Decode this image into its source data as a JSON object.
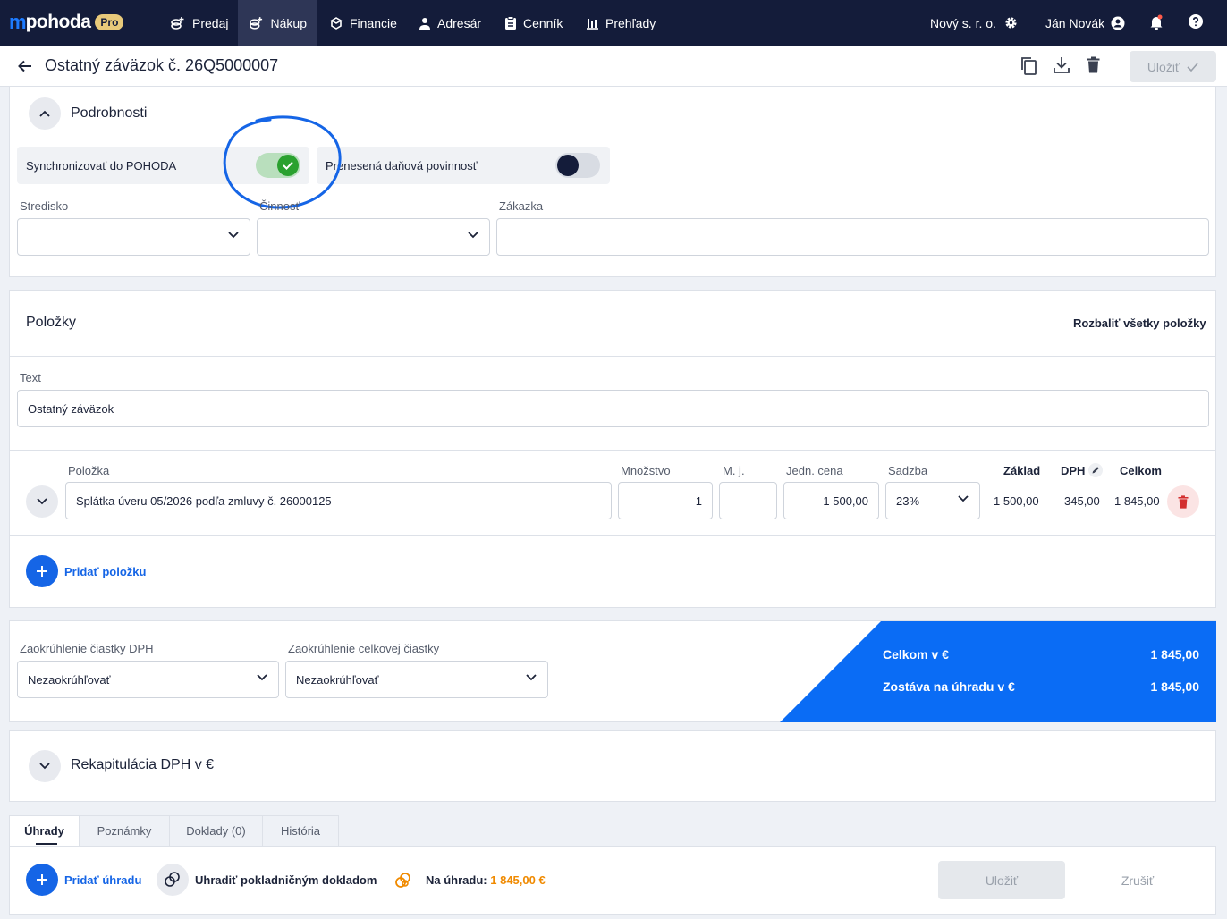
{
  "app": {
    "logo_mark": "m",
    "logo_text": "pohoda",
    "logo_badge": "Pro"
  },
  "nav": {
    "items": [
      {
        "label": "Predaj",
        "icon": "coins-plus-icon"
      },
      {
        "label": "Nákup",
        "icon": "coins-plus-icon",
        "active": true
      },
      {
        "label": "Financie",
        "icon": "finance-icon"
      },
      {
        "label": "Adresár",
        "icon": "person-icon"
      },
      {
        "label": "Cenník",
        "icon": "price-list-icon"
      },
      {
        "label": "Prehľady",
        "icon": "bar-chart-icon"
      }
    ],
    "company": "Nový s. r. o.",
    "user": "Ján Novák"
  },
  "header": {
    "title": "Ostatný záväzok č. 26Q5000007",
    "save_label": "Uložiť"
  },
  "details": {
    "title": "Podrobnosti",
    "sync_label": "Synchronizovať do POHODA",
    "sync_on": true,
    "reverse_charge_label": "Prenesená daňová povinnosť",
    "reverse_charge_on": false,
    "stredisko_label": "Stredisko",
    "cinnost_label": "Činnosť",
    "zakazka_label": "Zákazka"
  },
  "items": {
    "title": "Položky",
    "expand_all": "Rozbaliť všetky položky",
    "text_label": "Text",
    "text_value": "Ostatný záväzok",
    "columns": {
      "item": "Položka",
      "qty": "Množstvo",
      "unit": "M. j.",
      "unit_price": "Jedn. cena",
      "rate": "Sadzba",
      "base": "Základ",
      "vat": "DPH",
      "total": "Celkom"
    },
    "rows": [
      {
        "name": "Splátka úveru 05/2026 podľa zmluvy č. 26000125",
        "qty": "1",
        "unit": "",
        "unit_price": "1 500,00",
        "rate": "23%",
        "base": "1 500,00",
        "vat": "345,00",
        "total": "1 845,00"
      }
    ],
    "add_label": "Pridať položku"
  },
  "rounding": {
    "vat_label": "Zaokrúhlenie čiastky DPH",
    "vat_value": "Nezaokrúhľovať",
    "total_label": "Zaokrúhlenie celkovej čiastky",
    "total_value": "Nezaokrúhľovať"
  },
  "totals": {
    "total_label": "Celkom v €",
    "total_value": "1 845,00",
    "remaining_label": "Zostáva na úhradu v €",
    "remaining_value": "1 845,00",
    "accent": "#0a6cf5"
  },
  "recap": {
    "title": "Rekapitulácia DPH v €"
  },
  "tabs": [
    {
      "label": "Úhrady",
      "active": true
    },
    {
      "label": "Poznámky"
    },
    {
      "label": "Doklady (0)"
    },
    {
      "label": "História"
    }
  ],
  "payments": {
    "add_label": "Pridať úhradu",
    "cash_label": "Uhradiť pokladničným dokladom",
    "due_label": "Na úhradu:",
    "due_value": "1 845,00 €",
    "save_label": "Uložiť",
    "cancel_label": "Zrušiť"
  }
}
